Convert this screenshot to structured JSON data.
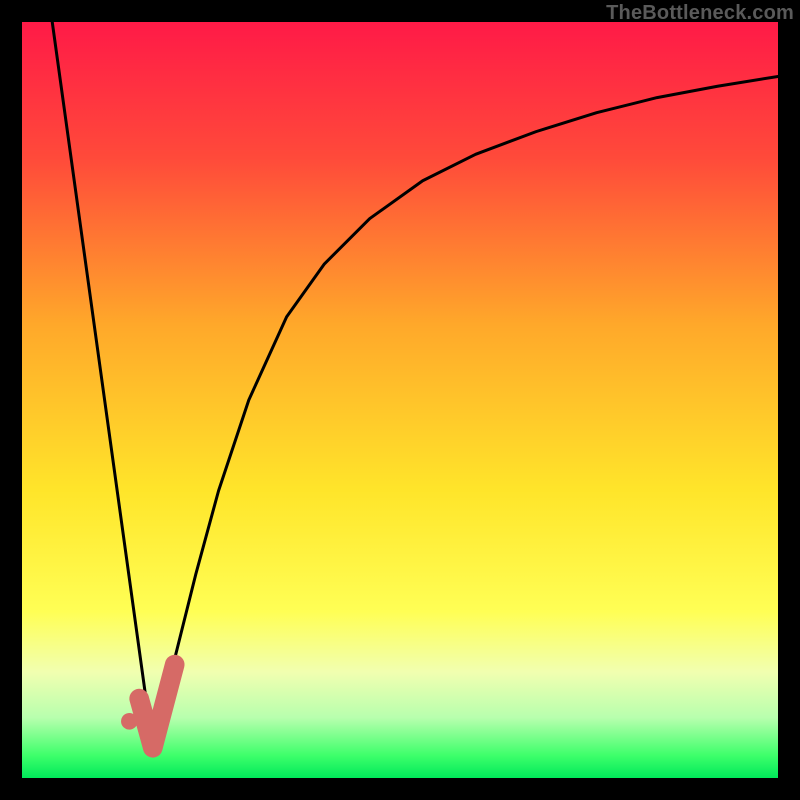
{
  "watermark": "TheBottleneck.com",
  "chart_data": {
    "type": "line",
    "title": "",
    "xlabel": "",
    "ylabel": "",
    "xlim": [
      0,
      100
    ],
    "ylim": [
      0,
      100
    ],
    "grid": false,
    "legend": false,
    "background_gradient": {
      "stops": [
        {
          "offset": 0.0,
          "color": "#ff1a47"
        },
        {
          "offset": 0.18,
          "color": "#ff4a3a"
        },
        {
          "offset": 0.4,
          "color": "#ffa82a"
        },
        {
          "offset": 0.62,
          "color": "#ffe52a"
        },
        {
          "offset": 0.78,
          "color": "#ffff55"
        },
        {
          "offset": 0.86,
          "color": "#f1ffb0"
        },
        {
          "offset": 0.92,
          "color": "#b8ffae"
        },
        {
          "offset": 0.97,
          "color": "#3eff6b"
        },
        {
          "offset": 1.0,
          "color": "#00e95a"
        }
      ]
    },
    "series": [
      {
        "name": "left-branch",
        "color": "#000000",
        "stroke_width": 3,
        "x": [
          4.0,
          17.3
        ],
        "y": [
          100.0,
          4.0
        ]
      },
      {
        "name": "right-branch",
        "color": "#000000",
        "stroke_width": 3,
        "x": [
          17.3,
          20,
          23,
          26,
          30,
          35,
          40,
          46,
          53,
          60,
          68,
          76,
          84,
          92,
          100
        ],
        "y": [
          4.0,
          15,
          27,
          38,
          50,
          61,
          68,
          74,
          79,
          82.5,
          85.5,
          88,
          90,
          91.5,
          92.8
        ]
      }
    ],
    "overlay_marker": {
      "type": "check",
      "color": "#d66a66",
      "dot": {
        "x": 14.2,
        "y": 7.5,
        "r": 1.1
      },
      "tick": {
        "x0": 15.5,
        "y0": 10.5,
        "x1": 17.3,
        "y1": 4.0,
        "x2": 20.2,
        "y2": 15.0,
        "width": 2.6
      }
    }
  }
}
